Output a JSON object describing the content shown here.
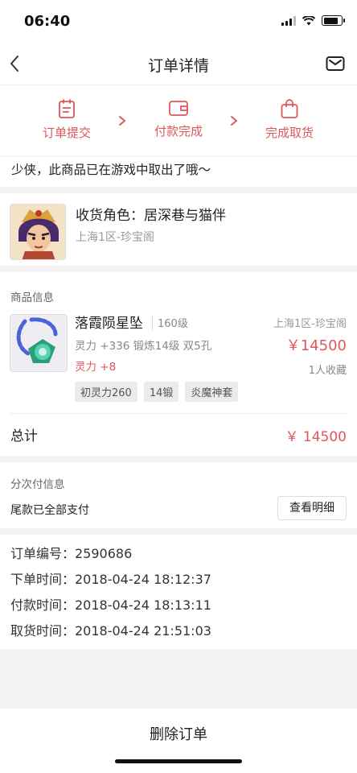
{
  "status_bar": {
    "time": "06:40"
  },
  "nav": {
    "title": "订单详情",
    "back_icon": "chevron-left-icon",
    "mail_icon": "mail-icon"
  },
  "progress": {
    "steps": [
      {
        "label": "订单提交",
        "icon": "clipboard-icon"
      },
      {
        "label": "付款完成",
        "icon": "wallet-icon"
      },
      {
        "label": "完成取货",
        "icon": "shopping-bag-icon"
      }
    ],
    "accent": "#e0565b"
  },
  "notice": "少侠，此商品已在游戏中取出了哦～",
  "role": {
    "name": "收货角色：居深巷与猫伴",
    "server": "上海1区-珍宝阁"
  },
  "goods": {
    "section_title": "商品信息",
    "name": "落霞陨星坠",
    "level": "160级",
    "server": "上海1区-珍宝阁",
    "attrs": "灵力 +336 锻炼14级 双5孔",
    "bonus": "灵力 +8",
    "price": "￥14500",
    "favorites": "1人收藏",
    "tags": [
      "初灵力260",
      "14锻",
      "炎魔神套"
    ],
    "total_label": "总计",
    "total_value": "￥ 14500"
  },
  "installment": {
    "title": "分次付信息",
    "status": "尾款已全部支付",
    "detail_button": "查看明细"
  },
  "order_info": [
    "订单编号：2590686",
    "下单时间：2018-04-24 18:12:37",
    "付款时间：2018-04-24 18:13:11",
    "取货时间：2018-04-24 21:51:03"
  ],
  "delete_button": "删除订单"
}
